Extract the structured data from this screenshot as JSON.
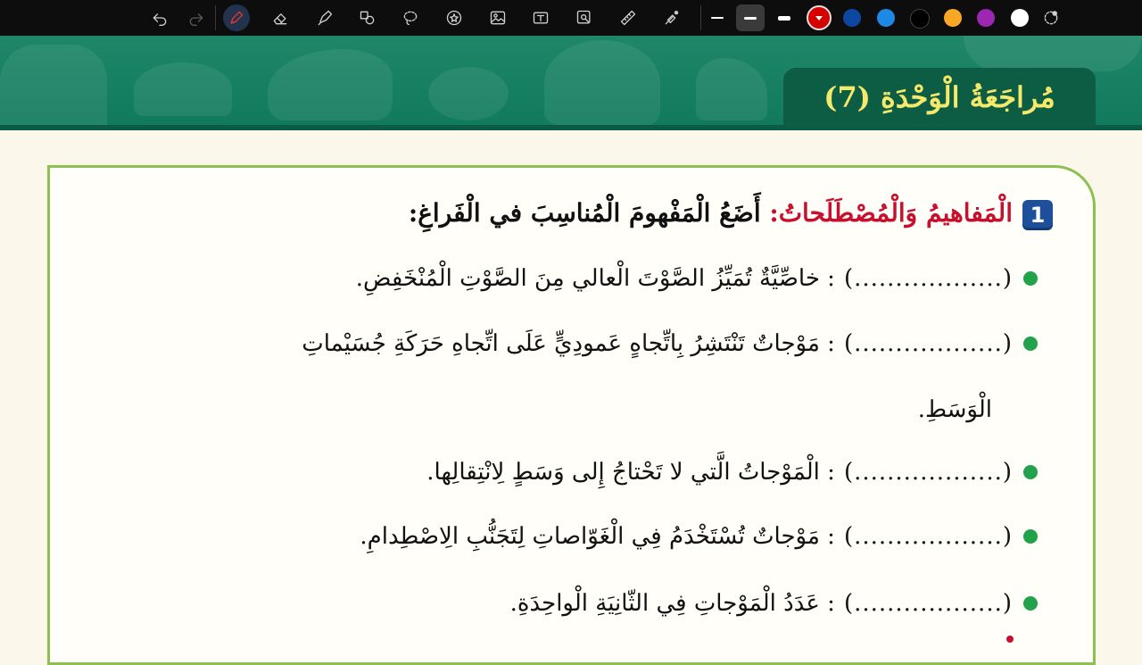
{
  "toolbar": {
    "tools": [
      {
        "icon": "undo-icon"
      },
      {
        "icon": "redo-icon"
      },
      {
        "icon": "pen-icon"
      },
      {
        "icon": "eraser-icon"
      },
      {
        "icon": "highlighter-icon"
      },
      {
        "icon": "shapes-icon"
      },
      {
        "icon": "lasso-icon"
      },
      {
        "icon": "sticker-icon"
      },
      {
        "icon": "image-icon"
      },
      {
        "icon": "text-box-icon"
      },
      {
        "icon": "image-search-icon"
      },
      {
        "icon": "ruler-icon"
      },
      {
        "icon": "laser-pointer-icon"
      }
    ],
    "line_widths": [
      "thin",
      "medium",
      "thick"
    ],
    "selected_line_width": "medium",
    "colors": [
      "#d50000",
      "#0d47a1",
      "#1e88e5",
      "#000000",
      "#f9a825",
      "#9c27b0",
      "#ffffff"
    ],
    "selected_color": "#d50000",
    "more_colors_icon": "color-picker-icon"
  },
  "banner": {
    "title": "مُراجَعَةُ الْوَحْدَةِ (7)"
  },
  "section": {
    "number": "1",
    "heading_red": "الْمَفاهيمُ وَالْمُصْطَلَحاتُ:",
    "heading_black": "أَضَعُ الْمَفْهومَ الْمُناسِبَ في الْفَراغِ:"
  },
  "items": [
    {
      "blank": "(..................)",
      "text": ": خاصِّيَّةٌ تُمَيِّزُ الصَّوْتَ الْعالي مِنَ الصَّوْتِ الْمُنْخَفِضِ."
    },
    {
      "blank": "(..................)",
      "text": ": مَوْجاتٌ تَنْتَشِرُ بِاتِّجاهٍ عَمودِيٍّ عَلَى اتِّجاهِ حَرَكَةِ جُسَيْماتِ",
      "continuation": "الْوَسَطِ."
    },
    {
      "blank": "(..................)",
      "text": ": الْمَوْجاتُ الَّتي لا تَحْتاجُ إِلى وَسَطٍ لِانْتِقالِها."
    },
    {
      "blank": "(..................)",
      "text": ": مَوْجاتٌ تُسْتَخْدَمُ فِي الْغَوّاصاتِ لِتَجَنُّبِ الِاصْطِدامِ."
    },
    {
      "blank": "(..................)",
      "text": ": عَدَدُ الْمَوْجاتِ فِي الثّانِيَةِ الْواحِدَةِ."
    }
  ]
}
